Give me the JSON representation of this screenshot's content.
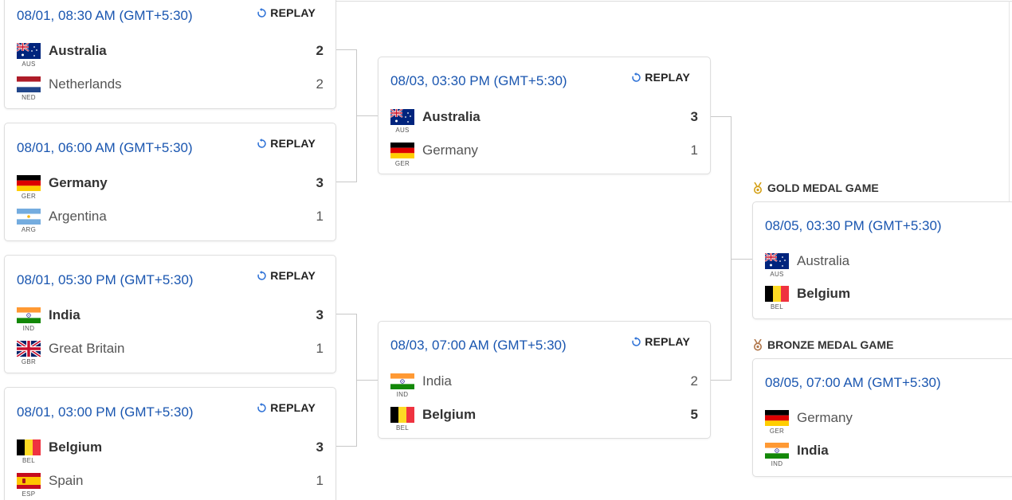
{
  "bracket": {
    "replay_label": "REPLAY",
    "quarterfinals": [
      {
        "time": "08/01, 08:30 AM (GMT+5:30)",
        "teams": [
          {
            "name": "Australia",
            "abbr": "AUS",
            "score": "2",
            "winner": true,
            "flag": "aus"
          },
          {
            "name": "Netherlands",
            "abbr": "NED",
            "score": "2",
            "winner": false,
            "flag": "ned"
          }
        ]
      },
      {
        "time": "08/01, 06:00 AM (GMT+5:30)",
        "teams": [
          {
            "name": "Germany",
            "abbr": "GER",
            "score": "3",
            "winner": true,
            "flag": "ger"
          },
          {
            "name": "Argentina",
            "abbr": "ARG",
            "score": "1",
            "winner": false,
            "flag": "arg"
          }
        ]
      },
      {
        "time": "08/01, 05:30 PM (GMT+5:30)",
        "teams": [
          {
            "name": "India",
            "abbr": "IND",
            "score": "3",
            "winner": true,
            "flag": "ind"
          },
          {
            "name": "Great Britain",
            "abbr": "GBR",
            "score": "1",
            "winner": false,
            "flag": "gbr"
          }
        ]
      },
      {
        "time": "08/01, 03:00 PM (GMT+5:30)",
        "teams": [
          {
            "name": "Belgium",
            "abbr": "BEL",
            "score": "3",
            "winner": true,
            "flag": "bel"
          },
          {
            "name": "Spain",
            "abbr": "ESP",
            "score": "1",
            "winner": false,
            "flag": "esp"
          }
        ]
      }
    ],
    "semifinals": [
      {
        "time": "08/03, 03:30 PM (GMT+5:30)",
        "teams": [
          {
            "name": "Australia",
            "abbr": "AUS",
            "score": "3",
            "winner": true,
            "flag": "aus"
          },
          {
            "name": "Germany",
            "abbr": "GER",
            "score": "1",
            "winner": false,
            "flag": "ger"
          }
        ]
      },
      {
        "time": "08/03, 07:00 AM (GMT+5:30)",
        "teams": [
          {
            "name": "India",
            "abbr": "IND",
            "score": "2",
            "winner": false,
            "flag": "ind"
          },
          {
            "name": "Belgium",
            "abbr": "BEL",
            "score": "5",
            "winner": true,
            "flag": "bel"
          }
        ]
      }
    ],
    "gold": {
      "title": "GOLD MEDAL GAME",
      "medal_color": "#d4a017",
      "time": "08/05, 03:30 PM (GMT+5:30)",
      "teams": [
        {
          "name": "Australia",
          "abbr": "AUS",
          "winner": false,
          "flag": "aus"
        },
        {
          "name": "Belgium",
          "abbr": "BEL",
          "winner": true,
          "flag": "bel"
        }
      ]
    },
    "bronze": {
      "title": "BRONZE MEDAL GAME",
      "medal_color": "#b0764a",
      "time": "08/05, 07:00 AM (GMT+5:30)",
      "teams": [
        {
          "name": "Germany",
          "abbr": "GER",
          "winner": false,
          "flag": "ger"
        },
        {
          "name": "India",
          "abbr": "IND",
          "winner": true,
          "flag": "ind"
        }
      ]
    }
  },
  "colors": {
    "time_text": "#1a56b0",
    "replay_icon": "#2a6fd6",
    "connector": "#c8c8c8"
  }
}
